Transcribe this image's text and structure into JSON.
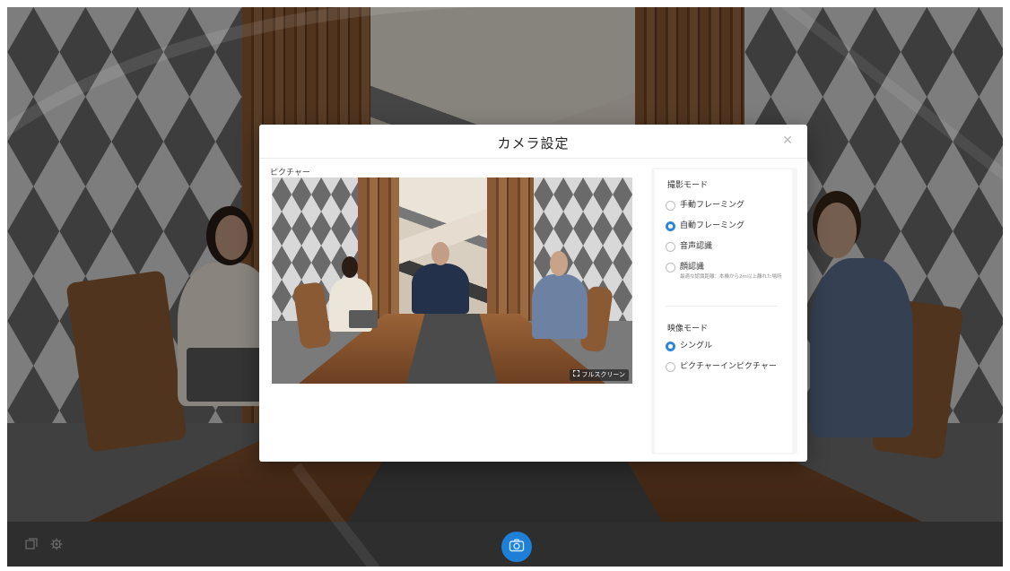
{
  "dialog": {
    "title": "カメラ設定",
    "close_icon": "close-icon",
    "picture_label": "ピクチャー",
    "fullscreen_label": "フルスクリーン",
    "fullscreen_icon": "expand-icon"
  },
  "shooting_mode": {
    "title": "撮影モード",
    "options": [
      {
        "label": "手動フレーミング",
        "selected": false
      },
      {
        "label": "自動フレーミング",
        "selected": true
      },
      {
        "label": "音声認識",
        "selected": false
      },
      {
        "label": "顔認識",
        "selected": false,
        "sub": "最適な認識距離：本機から2m以上離れた場所"
      }
    ]
  },
  "video_mode": {
    "title": "映像モード",
    "options": [
      {
        "label": "シングル",
        "selected": true
      },
      {
        "label": "ピクチャーインピクチャー",
        "selected": false
      }
    ]
  },
  "toolbar": {
    "left_icons": [
      "layout-icon",
      "settings-icon"
    ],
    "camera_icon": "camera-icon"
  },
  "colors": {
    "accent": "#2f86dc",
    "toolbar_bg": "#2e2e2e",
    "camera_button": "#1d7fd6"
  }
}
